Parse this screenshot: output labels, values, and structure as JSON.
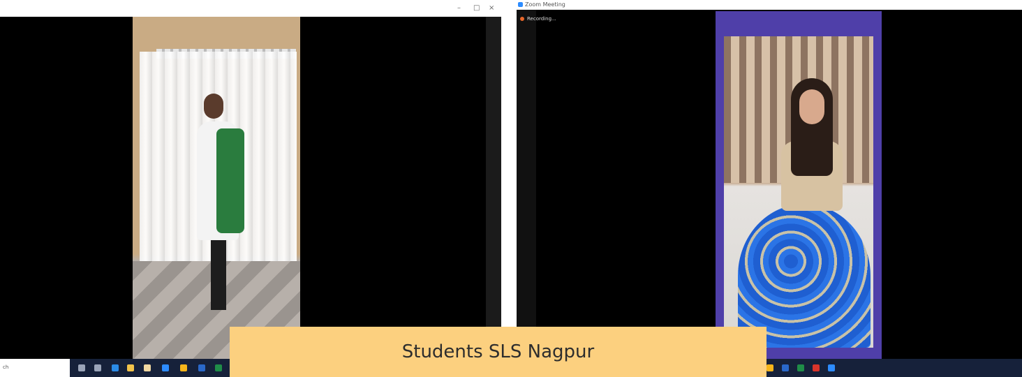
{
  "left_window": {
    "controls": {
      "minimize": "–",
      "maximize": "□",
      "close": "×"
    },
    "search_text": "ch"
  },
  "right_window": {
    "title": "Zoom Meeting",
    "recording_label": "Recording..."
  },
  "caption": {
    "text": "Students SLS Nagpur",
    "background": "#fcd07f"
  },
  "colors": {
    "taskbar": "#16213a",
    "zoom_frame": "#4f3fa9"
  }
}
